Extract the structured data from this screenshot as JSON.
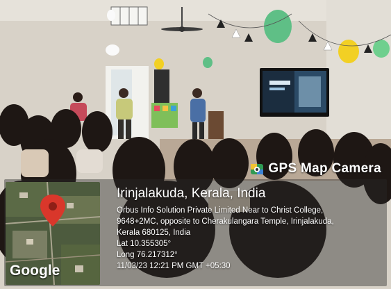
{
  "badge": {
    "label": "GPS Map Camera"
  },
  "map": {
    "watermark": "Google"
  },
  "location": {
    "title": "Irinjalakuda, Kerala, India",
    "address_lines": [
      "Orbus Info Solution Private Limited Near to Christ College,",
      "9648+2MC, opposite to Cherakulangara Temple, Irinjalakuda,",
      "Kerala 680125, India"
    ],
    "latitude": "Lat 10.355305°",
    "longitude": "Long 76.217312°",
    "timestamp": "11/03/23 12:21 PM GMT +05:30"
  },
  "colors": {
    "wall": "#d9d4cb",
    "screen_accent": "#3a8fd6",
    "balloon_green": "#5fbf86",
    "balloon_yellow": "#f2d024",
    "pin_red": "#d9372b"
  }
}
